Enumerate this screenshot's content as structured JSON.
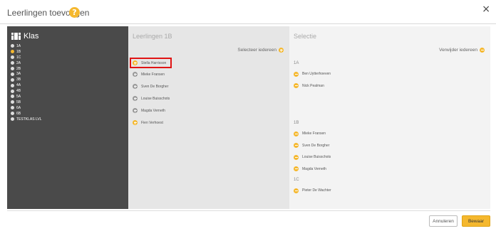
{
  "header": {
    "title": "Leerlingen toevoegen",
    "help_glyph": "?",
    "close_glyph": "×"
  },
  "klas": {
    "title": "Klas",
    "items": [
      {
        "label": "1A",
        "active": false
      },
      {
        "label": "1B",
        "active": true
      },
      {
        "label": "1C",
        "active": false
      },
      {
        "label": "2A",
        "active": false
      },
      {
        "label": "2B",
        "active": false
      },
      {
        "label": "3A",
        "active": false
      },
      {
        "label": "3B",
        "active": false
      },
      {
        "label": "4A",
        "active": false
      },
      {
        "label": "4B",
        "active": false
      },
      {
        "label": "5A",
        "active": false
      },
      {
        "label": "5B",
        "active": false
      },
      {
        "label": "6A",
        "active": false
      },
      {
        "label": "6B",
        "active": false
      },
      {
        "label": "TESTKLAS LVL",
        "active": false
      }
    ]
  },
  "leerlingen": {
    "title": "Leerlingen 1B",
    "select_all": "Selecteer iedereen",
    "students": [
      {
        "name": "Stella Harrisson",
        "state": "plus"
      },
      {
        "name": "Mieke Fransen",
        "state": "grey"
      },
      {
        "name": "Sven De Borgher",
        "state": "grey"
      },
      {
        "name": "Louise Buisschots",
        "state": "grey"
      },
      {
        "name": "Magda Verneth",
        "state": "grey"
      },
      {
        "name": "Fien Verhoest",
        "state": "plus"
      }
    ]
  },
  "selectie": {
    "title": "Selectie",
    "remove_all": "Verwijder iedereen",
    "groups": [
      {
        "label": "1A",
        "items": [
          "Ben Uytterhoeven",
          "Nick Pealman"
        ]
      },
      {
        "label": "1B",
        "items": [
          "Mieke Fransen",
          "Sven De Borgher",
          "Louise Buisschots",
          "Magda Verneth"
        ]
      },
      {
        "label": "1C",
        "items": [
          "Pieter De Wachter"
        ]
      }
    ]
  },
  "footer": {
    "cancel_label": "Annuleren",
    "save_label": "Bewaar"
  },
  "colors": {
    "accent": "#f5b82e",
    "dark_panel": "#4a4a4a",
    "highlight_border": "#e01414"
  }
}
